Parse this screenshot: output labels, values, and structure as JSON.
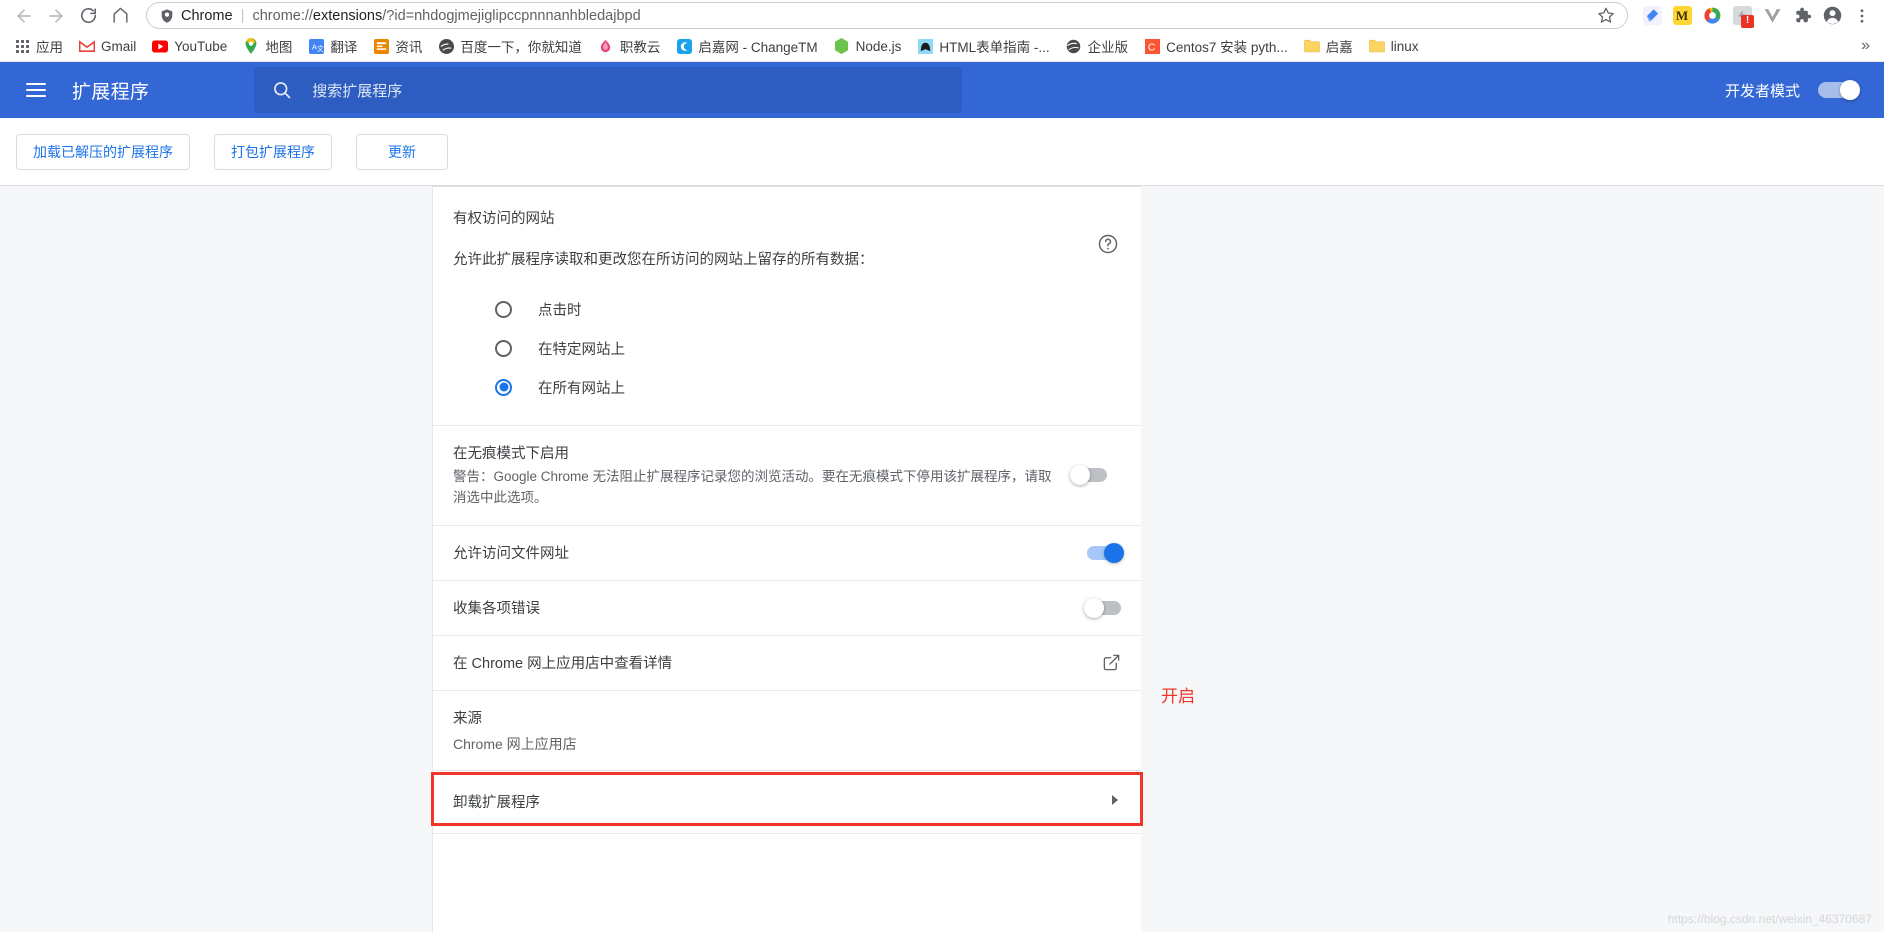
{
  "browser": {
    "nav": {
      "back": "back-arrow",
      "forward": "forward-arrow",
      "reload": "reload",
      "home": "home"
    },
    "omnibox": {
      "scheme_label": "Chrome",
      "url_prefix": "chrome://",
      "url_bold": "extensions",
      "url_suffix": "/?id=nhdogjmejiglipccpnnnanhbledajbpd",
      "full_url": "chrome://extensions/?id=nhdogjmejiglipccpnnnanhbledajbpd"
    },
    "toolbar_icons": [
      {
        "name": "kite-extension-icon",
        "glyph": "",
        "color": "#4285f4",
        "bg": "#f3f1fd"
      },
      {
        "name": "momentum-extension-icon",
        "glyph": "M",
        "color": "#3c2f00",
        "bg": "#fdd633"
      },
      {
        "name": "color-ring-extension-icon",
        "glyph": "",
        "color": "#ea4335",
        "bg": "transparent"
      },
      {
        "name": "disabled-extension-icon",
        "glyph": "",
        "color": "#9aa0a6",
        "bg": "#dadce0",
        "badge": "!"
      },
      {
        "name": "vue-devtools-icon",
        "glyph": "V",
        "color": "#9aa0a6",
        "bg": "transparent"
      },
      {
        "name": "puzzle-extensions-icon",
        "glyph": "",
        "color": "#5f6368",
        "bg": "transparent"
      },
      {
        "name": "profile-avatar-icon",
        "glyph": "",
        "color": "#5f6368",
        "bg": "transparent"
      },
      {
        "name": "chrome-menu-icon",
        "glyph": "",
        "color": "#5f6368",
        "bg": "transparent"
      }
    ],
    "bookmarks": [
      {
        "label": "应用",
        "icon": "apps-grid-icon"
      },
      {
        "label": "Gmail",
        "icon": "gmail-icon"
      },
      {
        "label": "YouTube",
        "icon": "youtube-icon"
      },
      {
        "label": "地图",
        "icon": "maps-pin-icon"
      },
      {
        "label": "翻译",
        "icon": "translate-icon"
      },
      {
        "label": "资讯",
        "icon": "news-icon"
      },
      {
        "label": "百度一下，你就知道",
        "icon": "baidu-icon"
      },
      {
        "label": "职教云",
        "icon": "zhijiaoyun-icon"
      },
      {
        "label": "启嘉网 - ChangeTM",
        "icon": "qijia-icon"
      },
      {
        "label": "Node.js",
        "icon": "nodejs-icon"
      },
      {
        "label": "HTML表单指南 -...",
        "icon": "mdn-icon"
      },
      {
        "label": "企业版",
        "icon": "globe-icon"
      },
      {
        "label": "Centos7 安装 pyth...",
        "icon": "csdn-icon"
      },
      {
        "label": "启嘉",
        "icon": "folder-icon"
      },
      {
        "label": "linux",
        "icon": "folder-icon"
      }
    ],
    "bookmarks_overflow": "»"
  },
  "page": {
    "header": {
      "menu_icon": "hamburger-menu-icon",
      "title": "扩展程序",
      "search_placeholder": "搜索扩展程序",
      "search_icon": "search-icon",
      "dev_mode_label": "开发者模式",
      "dev_mode_on": true
    },
    "toolbar": {
      "load_unpacked": "加载已解压的扩展程序",
      "pack_extension": "打包扩展程序",
      "update": "更新"
    },
    "permissions": {
      "section_title": "有权访问的网站",
      "description": "允许此扩展程序读取和更改您在所访问的网站上留存的所有数据：",
      "help_icon": "help-circle-icon",
      "options": [
        {
          "label": "点击时",
          "selected": false
        },
        {
          "label": "在特定网站上",
          "selected": false
        },
        {
          "label": "在所有网站上",
          "selected": true
        }
      ]
    },
    "rows": [
      {
        "name": "incognito-row",
        "title": "在无痕模式下启用",
        "subtitle": "警告：Google Chrome 无法阻止扩展程序记录您的浏览活动。要在无痕模式下停用该扩展程序，请取消选中此选项。",
        "control": "toggle",
        "on": false
      },
      {
        "name": "file-urls-row",
        "title": "允许访问文件网址",
        "control": "toggle",
        "on": true,
        "highlighted": true
      },
      {
        "name": "collect-errors-row",
        "title": "收集各项错误",
        "control": "toggle",
        "on": false
      },
      {
        "name": "webstore-details-row",
        "title": "在 Chrome 网上应用店中查看详情",
        "control": "external-link"
      },
      {
        "name": "source-row",
        "title": "来源",
        "subtitle": "Chrome 网上应用店",
        "control": "none"
      },
      {
        "name": "remove-extension-row",
        "title": "卸载扩展程序",
        "control": "chevron"
      }
    ],
    "annotation": {
      "text": "开启",
      "color": "#f0352b"
    },
    "watermark": "https://blog.csdn.net/weixin_46370687"
  }
}
